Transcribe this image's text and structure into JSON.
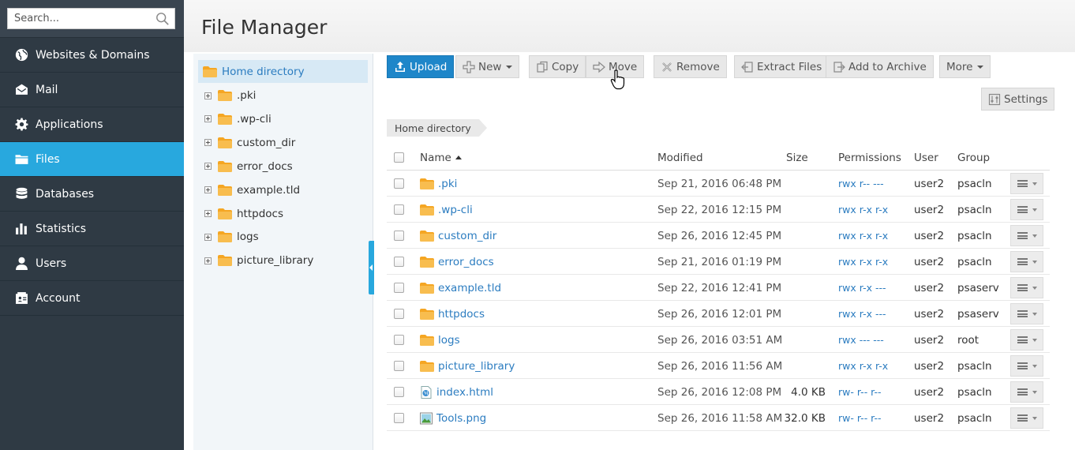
{
  "sidebar": {
    "search_placeholder": "Search...",
    "items": [
      {
        "label": "Websites & Domains",
        "icon": "globe-icon"
      },
      {
        "label": "Mail",
        "icon": "mail-icon"
      },
      {
        "label": "Applications",
        "icon": "gear-icon"
      },
      {
        "label": "Files",
        "icon": "folder-icon",
        "active": true
      },
      {
        "label": "Databases",
        "icon": "database-icon"
      },
      {
        "label": "Statistics",
        "icon": "bar-chart-icon"
      },
      {
        "label": "Users",
        "icon": "user-icon"
      },
      {
        "label": "Account",
        "icon": "account-icon"
      }
    ]
  },
  "header": {
    "title": "File Manager"
  },
  "tree": {
    "root": "Home directory",
    "items": [
      ".pki",
      ".wp-cli",
      "custom_dir",
      "error_docs",
      "example.tld",
      "httpdocs",
      "logs",
      "picture_library"
    ]
  },
  "toolbar": {
    "upload": "Upload",
    "new": "New",
    "copy": "Copy",
    "move": "Move",
    "remove": "Remove",
    "extract": "Extract Files",
    "archive": "Add to Archive",
    "more": "More",
    "settings": "Settings"
  },
  "breadcrumb": "Home directory",
  "table": {
    "headers": {
      "name": "Name",
      "modified": "Modified",
      "size": "Size",
      "permissions": "Permissions",
      "user": "User",
      "group": "Group"
    },
    "rows": [
      {
        "name": ".pki",
        "modified": "Sep 21, 2016 06:48 PM",
        "size": "",
        "perm": "rwx r-- ---",
        "user": "user2",
        "group": "psacln",
        "type": "folder"
      },
      {
        "name": ".wp-cli",
        "modified": "Sep 22, 2016 12:15 PM",
        "size": "",
        "perm": "rwx r-x r-x",
        "user": "user2",
        "group": "psacln",
        "type": "folder"
      },
      {
        "name": "custom_dir",
        "modified": "Sep 26, 2016 12:45 PM",
        "size": "",
        "perm": "rwx r-x r-x",
        "user": "user2",
        "group": "psacln",
        "type": "folder"
      },
      {
        "name": "error_docs",
        "modified": "Sep 21, 2016 01:19 PM",
        "size": "",
        "perm": "rwx r-x r-x",
        "user": "user2",
        "group": "psacln",
        "type": "folder"
      },
      {
        "name": "example.tld",
        "modified": "Sep 22, 2016 12:41 PM",
        "size": "",
        "perm": "rwx r-x ---",
        "user": "user2",
        "group": "psaserv",
        "type": "folder"
      },
      {
        "name": "httpdocs",
        "modified": "Sep 26, 2016 12:01 PM",
        "size": "",
        "perm": "rwx r-x ---",
        "user": "user2",
        "group": "psaserv",
        "type": "folder"
      },
      {
        "name": "logs",
        "modified": "Sep 26, 2016 03:51 AM",
        "size": "",
        "perm": "rwx --- ---",
        "user": "user2",
        "group": "root",
        "type": "folder"
      },
      {
        "name": "picture_library",
        "modified": "Sep 26, 2016 11:56 AM",
        "size": "",
        "perm": "rwx r-x r-x",
        "user": "user2",
        "group": "psacln",
        "type": "folder"
      },
      {
        "name": "index.html",
        "modified": "Sep 26, 2016 12:08 PM",
        "size": "4.0 KB",
        "perm": "rw- r-- r--",
        "user": "user2",
        "group": "psacln",
        "type": "html"
      },
      {
        "name": "Tools.png",
        "modified": "Sep 26, 2016 11:58 AM",
        "size": "32.0 KB",
        "perm": "rw- r-- r--",
        "user": "user2",
        "group": "psacln",
        "type": "image"
      }
    ]
  },
  "colors": {
    "accent": "#28a8de",
    "primary_button": "#1e86c9",
    "link": "#2b7cc0",
    "folder": "#f5a623",
    "sidebar": "#2f3a44"
  }
}
